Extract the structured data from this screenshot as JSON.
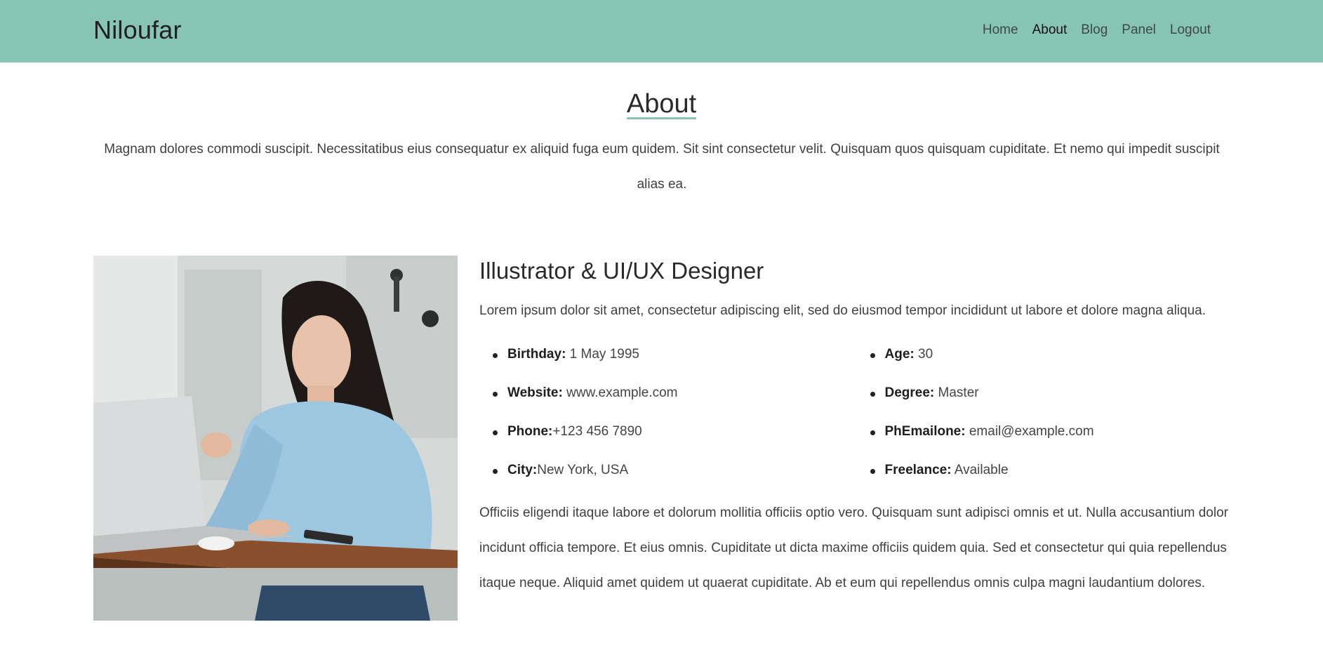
{
  "header": {
    "brand": "Niloufar",
    "nav": [
      "Home",
      "About",
      "Blog",
      "Panel",
      "Logout"
    ],
    "active": "About",
    "bg_color": "#87c4b3"
  },
  "about": {
    "title": "About",
    "intro": "Magnam dolores commodi suscipit. Necessitatibus eius consequatur ex aliquid fuga eum quidem. Sit sint consectetur velit. Quisquam quos quisquam cupiditate. Et nemo qui impedit suscipit alias ea.",
    "photo_alt": "Woman working on a laptop at a wooden desk",
    "role_title": "Illustrator & UI/UX Designer",
    "lead": "Lorem ipsum dolor sit amet, consectetur adipiscing elit, sed do eiusmod tempor incididunt ut labore et dolore magna aliqua.",
    "details_left": [
      {
        "label": "Birthday:",
        "value": " 1 May 1995"
      },
      {
        "label": "Website:",
        "value": " www.example.com"
      },
      {
        "label": "Phone:",
        "value": "+123 456 7890"
      },
      {
        "label": "City:",
        "value": "New York, USA"
      }
    ],
    "details_right": [
      {
        "label": "Age:",
        "value": " 30"
      },
      {
        "label": "Degree:",
        "value": " Master"
      },
      {
        "label": "PhEmailone:",
        "value": " email@example.com"
      },
      {
        "label": "Freelance:",
        "value": " Available"
      }
    ],
    "bio": "Officiis eligendi itaque labore et dolorum mollitia officiis optio vero. Quisquam sunt adipisci omnis et ut. Nulla accusantium dolor incidunt officia tempore. Et eius omnis. Cupiditate ut dicta maxime officiis quidem quia. Sed et consectetur qui quia repellendus itaque neque. Aliquid amet quidem ut quaerat cupiditate. Ab et eum qui repellendus omnis culpa magni laudantium dolores."
  }
}
